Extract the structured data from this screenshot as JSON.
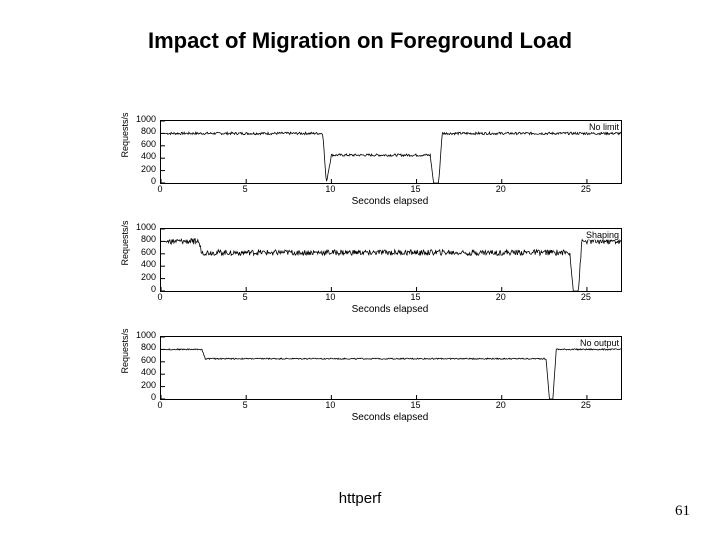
{
  "title": "Impact of Migration on Foreground Load",
  "caption": "httperf",
  "page_number": "61",
  "chart_data": [
    {
      "type": "line",
      "series_name": "No limit",
      "xlabel": "Seconds elapsed",
      "ylabel": "Requests/s",
      "xlim": [
        0,
        27
      ],
      "ylim": [
        0,
        1000
      ],
      "yticks": [
        0,
        200,
        400,
        600,
        800,
        1000
      ],
      "xticks": [
        0,
        5,
        10,
        15,
        20,
        25
      ],
      "x": [
        0,
        0.5,
        9.5,
        9.7,
        10,
        15.8,
        16.0,
        16.3,
        16.5,
        27
      ],
      "y": [
        800,
        800,
        800,
        0,
        450,
        450,
        0,
        0,
        800,
        800
      ],
      "noise_amp": 40
    },
    {
      "type": "line",
      "series_name": "Shaping",
      "xlabel": "Seconds elapsed",
      "ylabel": "Requests/s",
      "xlim": [
        0,
        27
      ],
      "ylim": [
        0,
        1000
      ],
      "yticks": [
        0,
        200,
        400,
        600,
        800,
        1000
      ],
      "xticks": [
        0,
        5,
        10,
        15,
        20,
        25
      ],
      "x": [
        0,
        0.5,
        2.2,
        2.4,
        24.0,
        24.2,
        24.5,
        24.7,
        27
      ],
      "y": [
        800,
        800,
        800,
        620,
        620,
        0,
        0,
        800,
        800
      ],
      "noise_amp": 90
    },
    {
      "type": "line",
      "series_name": "No output",
      "xlabel": "Seconds elapsed",
      "ylabel": "Requests/s",
      "xlim": [
        0,
        27
      ],
      "ylim": [
        0,
        1000
      ],
      "yticks": [
        0,
        200,
        400,
        600,
        800,
        1000
      ],
      "xticks": [
        0,
        5,
        10,
        15,
        20,
        25
      ],
      "x": [
        0,
        0.5,
        2.4,
        2.6,
        22.6,
        22.8,
        23.0,
        23.2,
        27
      ],
      "y": [
        800,
        800,
        800,
        650,
        650,
        0,
        0,
        800,
        800
      ],
      "noise_amp": 20
    }
  ]
}
